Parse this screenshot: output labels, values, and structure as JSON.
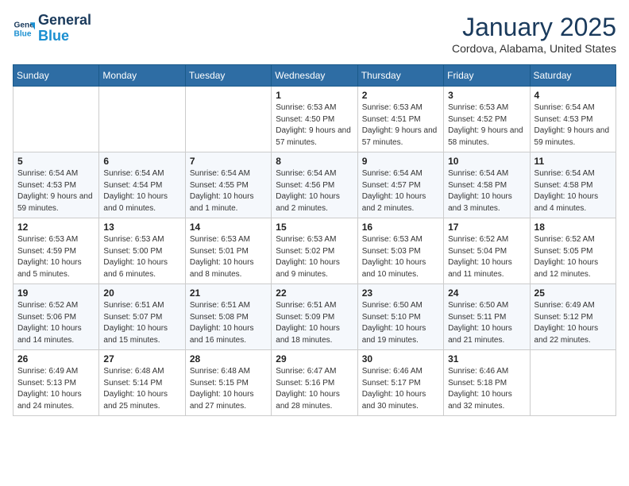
{
  "header": {
    "logo_line1": "General",
    "logo_line2": "Blue",
    "title": "January 2025",
    "subtitle": "Cordova, Alabama, United States"
  },
  "weekdays": [
    "Sunday",
    "Monday",
    "Tuesday",
    "Wednesday",
    "Thursday",
    "Friday",
    "Saturday"
  ],
  "weeks": [
    [
      {
        "day": "",
        "sunrise": "",
        "sunset": "",
        "daylight": ""
      },
      {
        "day": "",
        "sunrise": "",
        "sunset": "",
        "daylight": ""
      },
      {
        "day": "",
        "sunrise": "",
        "sunset": "",
        "daylight": ""
      },
      {
        "day": "1",
        "sunrise": "Sunrise: 6:53 AM",
        "sunset": "Sunset: 4:50 PM",
        "daylight": "Daylight: 9 hours and 57 minutes."
      },
      {
        "day": "2",
        "sunrise": "Sunrise: 6:53 AM",
        "sunset": "Sunset: 4:51 PM",
        "daylight": "Daylight: 9 hours and 57 minutes."
      },
      {
        "day": "3",
        "sunrise": "Sunrise: 6:53 AM",
        "sunset": "Sunset: 4:52 PM",
        "daylight": "Daylight: 9 hours and 58 minutes."
      },
      {
        "day": "4",
        "sunrise": "Sunrise: 6:54 AM",
        "sunset": "Sunset: 4:53 PM",
        "daylight": "Daylight: 9 hours and 59 minutes."
      }
    ],
    [
      {
        "day": "5",
        "sunrise": "Sunrise: 6:54 AM",
        "sunset": "Sunset: 4:53 PM",
        "daylight": "Daylight: 9 hours and 59 minutes."
      },
      {
        "day": "6",
        "sunrise": "Sunrise: 6:54 AM",
        "sunset": "Sunset: 4:54 PM",
        "daylight": "Daylight: 10 hours and 0 minutes."
      },
      {
        "day": "7",
        "sunrise": "Sunrise: 6:54 AM",
        "sunset": "Sunset: 4:55 PM",
        "daylight": "Daylight: 10 hours and 1 minute."
      },
      {
        "day": "8",
        "sunrise": "Sunrise: 6:54 AM",
        "sunset": "Sunset: 4:56 PM",
        "daylight": "Daylight: 10 hours and 2 minutes."
      },
      {
        "day": "9",
        "sunrise": "Sunrise: 6:54 AM",
        "sunset": "Sunset: 4:57 PM",
        "daylight": "Daylight: 10 hours and 2 minutes."
      },
      {
        "day": "10",
        "sunrise": "Sunrise: 6:54 AM",
        "sunset": "Sunset: 4:58 PM",
        "daylight": "Daylight: 10 hours and 3 minutes."
      },
      {
        "day": "11",
        "sunrise": "Sunrise: 6:54 AM",
        "sunset": "Sunset: 4:58 PM",
        "daylight": "Daylight: 10 hours and 4 minutes."
      }
    ],
    [
      {
        "day": "12",
        "sunrise": "Sunrise: 6:53 AM",
        "sunset": "Sunset: 4:59 PM",
        "daylight": "Daylight: 10 hours and 5 minutes."
      },
      {
        "day": "13",
        "sunrise": "Sunrise: 6:53 AM",
        "sunset": "Sunset: 5:00 PM",
        "daylight": "Daylight: 10 hours and 6 minutes."
      },
      {
        "day": "14",
        "sunrise": "Sunrise: 6:53 AM",
        "sunset": "Sunset: 5:01 PM",
        "daylight": "Daylight: 10 hours and 8 minutes."
      },
      {
        "day": "15",
        "sunrise": "Sunrise: 6:53 AM",
        "sunset": "Sunset: 5:02 PM",
        "daylight": "Daylight: 10 hours and 9 minutes."
      },
      {
        "day": "16",
        "sunrise": "Sunrise: 6:53 AM",
        "sunset": "Sunset: 5:03 PM",
        "daylight": "Daylight: 10 hours and 10 minutes."
      },
      {
        "day": "17",
        "sunrise": "Sunrise: 6:52 AM",
        "sunset": "Sunset: 5:04 PM",
        "daylight": "Daylight: 10 hours and 11 minutes."
      },
      {
        "day": "18",
        "sunrise": "Sunrise: 6:52 AM",
        "sunset": "Sunset: 5:05 PM",
        "daylight": "Daylight: 10 hours and 12 minutes."
      }
    ],
    [
      {
        "day": "19",
        "sunrise": "Sunrise: 6:52 AM",
        "sunset": "Sunset: 5:06 PM",
        "daylight": "Daylight: 10 hours and 14 minutes."
      },
      {
        "day": "20",
        "sunrise": "Sunrise: 6:51 AM",
        "sunset": "Sunset: 5:07 PM",
        "daylight": "Daylight: 10 hours and 15 minutes."
      },
      {
        "day": "21",
        "sunrise": "Sunrise: 6:51 AM",
        "sunset": "Sunset: 5:08 PM",
        "daylight": "Daylight: 10 hours and 16 minutes."
      },
      {
        "day": "22",
        "sunrise": "Sunrise: 6:51 AM",
        "sunset": "Sunset: 5:09 PM",
        "daylight": "Daylight: 10 hours and 18 minutes."
      },
      {
        "day": "23",
        "sunrise": "Sunrise: 6:50 AM",
        "sunset": "Sunset: 5:10 PM",
        "daylight": "Daylight: 10 hours and 19 minutes."
      },
      {
        "day": "24",
        "sunrise": "Sunrise: 6:50 AM",
        "sunset": "Sunset: 5:11 PM",
        "daylight": "Daylight: 10 hours and 21 minutes."
      },
      {
        "day": "25",
        "sunrise": "Sunrise: 6:49 AM",
        "sunset": "Sunset: 5:12 PM",
        "daylight": "Daylight: 10 hours and 22 minutes."
      }
    ],
    [
      {
        "day": "26",
        "sunrise": "Sunrise: 6:49 AM",
        "sunset": "Sunset: 5:13 PM",
        "daylight": "Daylight: 10 hours and 24 minutes."
      },
      {
        "day": "27",
        "sunrise": "Sunrise: 6:48 AM",
        "sunset": "Sunset: 5:14 PM",
        "daylight": "Daylight: 10 hours and 25 minutes."
      },
      {
        "day": "28",
        "sunrise": "Sunrise: 6:48 AM",
        "sunset": "Sunset: 5:15 PM",
        "daylight": "Daylight: 10 hours and 27 minutes."
      },
      {
        "day": "29",
        "sunrise": "Sunrise: 6:47 AM",
        "sunset": "Sunset: 5:16 PM",
        "daylight": "Daylight: 10 hours and 28 minutes."
      },
      {
        "day": "30",
        "sunrise": "Sunrise: 6:46 AM",
        "sunset": "Sunset: 5:17 PM",
        "daylight": "Daylight: 10 hours and 30 minutes."
      },
      {
        "day": "31",
        "sunrise": "Sunrise: 6:46 AM",
        "sunset": "Sunset: 5:18 PM",
        "daylight": "Daylight: 10 hours and 32 minutes."
      },
      {
        "day": "",
        "sunrise": "",
        "sunset": "",
        "daylight": ""
      }
    ]
  ]
}
